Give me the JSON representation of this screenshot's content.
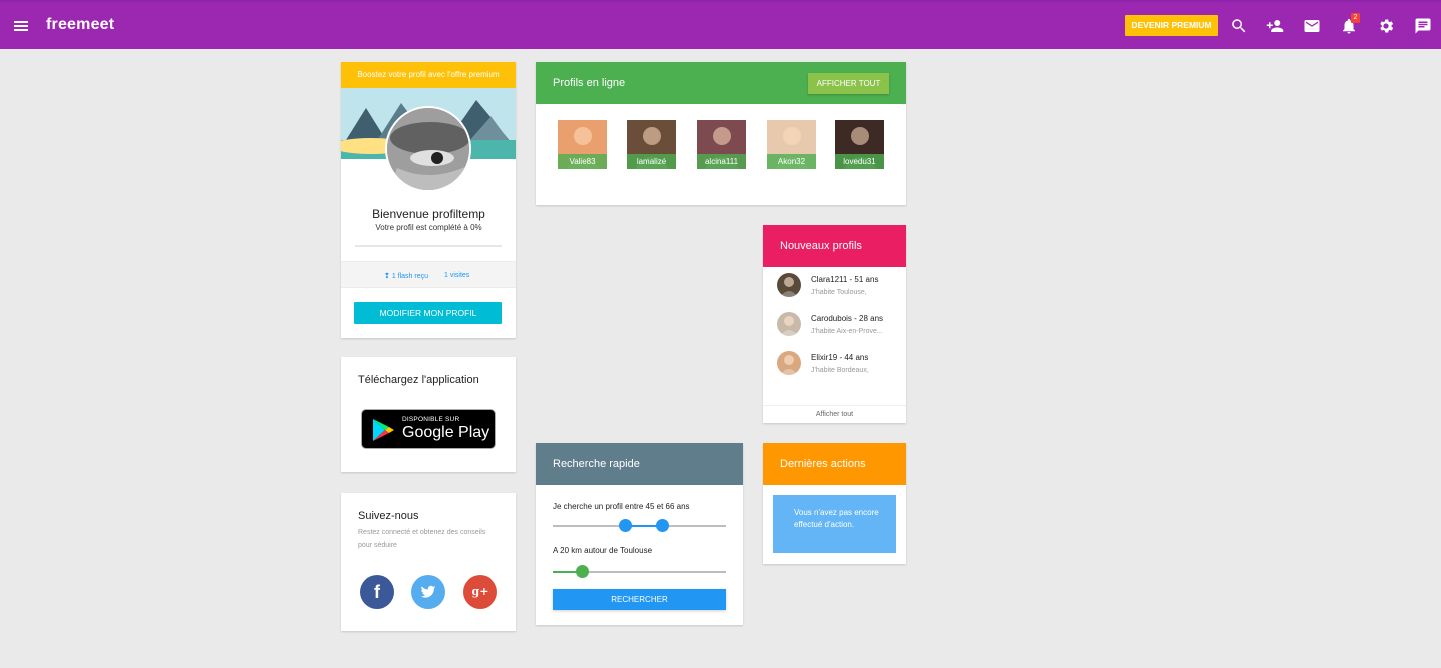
{
  "app": {
    "logo": "freemeet"
  },
  "topbar": {
    "premium_label": "DEVENIR PREMIUM",
    "notification_count": "2",
    "icons": [
      "menu-icon",
      "search-icon",
      "add-user-icon",
      "mail-icon",
      "bell-icon",
      "gear-icon",
      "chat-icon"
    ]
  },
  "profile_card": {
    "boost_banner": "Boostez votre profil avec l'offre premium",
    "welcome": "Bienvenue profiltemp",
    "completion": "Votre profil est complété à 0%",
    "completion_percent": 0,
    "flash": "1 flash reçu",
    "visits": "1 visites",
    "modify_label": "MODIFIER MON PROFIL"
  },
  "app_card": {
    "title": "Téléchargez l'application",
    "badge_small": "DISPONIBLE SUR",
    "badge_big": "Google Play"
  },
  "follow_card": {
    "title": "Suivez-nous",
    "description": "Restez connecté et obtenez des conseils pour séduire",
    "networks": [
      {
        "name": "facebook",
        "glyph": "f",
        "color": "#3b5998"
      },
      {
        "name": "twitter",
        "glyph": "t",
        "color": "#55acee"
      },
      {
        "name": "google-plus",
        "glyph": "g+",
        "color": "#dd4b39"
      }
    ]
  },
  "online": {
    "title": "Profils en ligne",
    "show_all": "AFFICHER TOUT",
    "color": "#4caf50",
    "users": [
      {
        "name": "Valie83",
        "bg": "#e9a06e"
      },
      {
        "name": "lamalizé",
        "bg": "#6a4e3a"
      },
      {
        "name": "alcina111",
        "bg": "#7d4a4f"
      },
      {
        "name": "Akon32",
        "bg": "#e7c9ad"
      },
      {
        "name": "lovedu31",
        "bg": "#3d2a24"
      }
    ]
  },
  "new_profiles": {
    "title": "Nouveaux profils",
    "color": "#e91e63",
    "items": [
      {
        "name": "Clara1211 - 51 ans",
        "city": "J'habite Toulouse,",
        "bg": "#5a4a3a"
      },
      {
        "name": "Carodubois - 28 ans",
        "city": "J'habite Aix-en-Prove...",
        "bg": "#c9b9a9"
      },
      {
        "name": "Elixir19 - 44 ans",
        "city": "J'habite Bordeaux,",
        "bg": "#d9a880"
      }
    ],
    "show_all": "Afficher tout"
  },
  "quick_search": {
    "title": "Recherche rapide",
    "color": "#607d8b",
    "age_label": "Je cherche un profil entre 45 et 66 ans",
    "age_min": 45,
    "age_max": 66,
    "distance_label": "A 20 km autour de Toulouse",
    "distance_km": 20,
    "button": "RECHERCHER"
  },
  "last_actions": {
    "title": "Dernières actions",
    "color": "#ff9800",
    "empty_message": "Vous n'avez pas encore effectué d'action."
  }
}
